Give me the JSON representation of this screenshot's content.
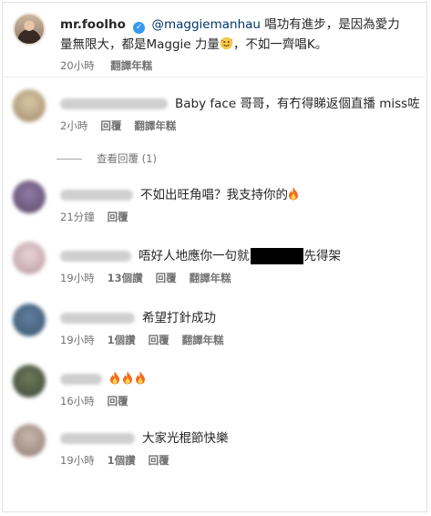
{
  "main_comment": {
    "username": "mr.foolho",
    "mention": "@maggiemanhau",
    "text_part1": "唱功有進步，是因為愛力量無限大，都是Maggie 力量",
    "text_part2": "，不如一齊唱K。",
    "time": "20小時",
    "translate": "翻譯年糕"
  },
  "replies": [
    {
      "text_before": "Baby face 哥哥，有冇得睇返個直播 miss咗",
      "text_after": "",
      "fire_count": 0,
      "redacted": false,
      "time": "2小時",
      "likes": "",
      "reply": "回覆",
      "translate": "翻譯年糕",
      "colors": [
        "#d9c7a4",
        "#9d8a6c"
      ]
    },
    {
      "text_before": "不如出旺角唱？我支持你的",
      "text_after": "",
      "fire_count": 1,
      "redacted": false,
      "time": "21分鐘",
      "likes": "",
      "reply": "回覆",
      "translate": "",
      "colors": [
        "#8f7aa6",
        "#5a4a67"
      ]
    },
    {
      "text_before": "唔好人地應你一句就",
      "text_after": "先得架",
      "fire_count": 0,
      "redacted": true,
      "time": "19小時",
      "likes": "13個讚",
      "reply": "回覆",
      "translate": "翻譯年糕",
      "colors": [
        "#e7d3d6",
        "#b79aa2"
      ]
    },
    {
      "text_before": "希望打針成功",
      "text_after": "",
      "fire_count": 0,
      "redacted": false,
      "time": "19小時",
      "likes": "1個讚",
      "reply": "回覆",
      "translate": "翻譯年糕",
      "colors": [
        "#5f7e9d",
        "#3b5670"
      ]
    },
    {
      "text_before": "",
      "text_after": "",
      "fire_count": 3,
      "redacted": false,
      "time": "16小時",
      "likes": "",
      "reply": "回覆",
      "translate": "",
      "colors": [
        "#6d7a5a",
        "#3d4636"
      ]
    },
    {
      "text_before": "大家光棍節快樂",
      "text_after": "",
      "fire_count": 0,
      "redacted": false,
      "time": "19小時",
      "likes": "1個讚",
      "reply": "回覆",
      "translate": "",
      "colors": [
        "#c9b7ad",
        "#8f7b72"
      ]
    }
  ],
  "view_replies": "查看回覆 (1)",
  "colors": {
    "text": "#262626",
    "meta": "#737373",
    "mention": "#00376b",
    "verified": "#3897f0"
  },
  "icons": {
    "verified": "verified-badge-icon",
    "emoji_top": "smiling-face-hearts-icon",
    "fire": "fire-icon"
  }
}
